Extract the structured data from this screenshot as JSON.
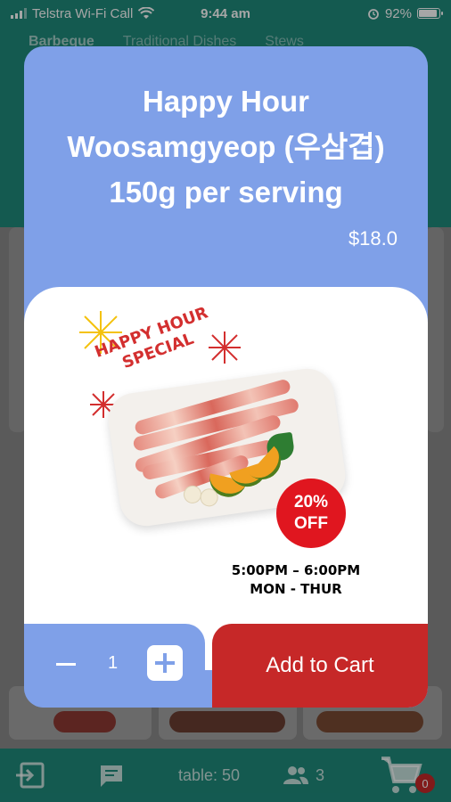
{
  "status_bar": {
    "carrier": "Telstra Wi-Fi Call",
    "time": "9:44 am",
    "battery": "92%"
  },
  "background": {
    "tabs": [
      "Barbeque",
      "Traditional Dishes",
      "Stews"
    ],
    "bottom_bar": {
      "table_label": "table: 50",
      "guests": "3",
      "cart_count": "0"
    }
  },
  "modal": {
    "title": "Happy Hour Woosamgyeop (우삼겹) 150g per serving",
    "price": "$18.0",
    "image": {
      "headline_line1": "HAPPY HOUR",
      "headline_line2": "SPECIAL",
      "discount_line1": "20%",
      "discount_line2": "OFF",
      "time_range": "5:00PM – 6:00PM",
      "days": "MON - THUR"
    },
    "quantity": "1",
    "add_to_cart_label": "Add to Cart"
  },
  "colors": {
    "teal": "#1f8a7c",
    "modal_blue": "#7fa0e8",
    "cart_red": "#c62828",
    "badge_red": "#e0161f"
  }
}
